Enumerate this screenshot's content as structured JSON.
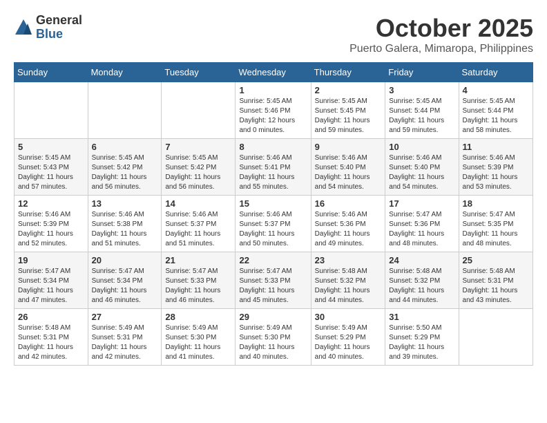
{
  "logo": {
    "general": "General",
    "blue": "Blue"
  },
  "title": "October 2025",
  "location": "Puerto Galera, Mimaropa, Philippines",
  "days_of_week": [
    "Sunday",
    "Monday",
    "Tuesday",
    "Wednesday",
    "Thursday",
    "Friday",
    "Saturday"
  ],
  "weeks": [
    [
      {
        "day": "",
        "info": ""
      },
      {
        "day": "",
        "info": ""
      },
      {
        "day": "",
        "info": ""
      },
      {
        "day": "1",
        "info": "Sunrise: 5:45 AM\nSunset: 5:46 PM\nDaylight: 12 hours\nand 0 minutes."
      },
      {
        "day": "2",
        "info": "Sunrise: 5:45 AM\nSunset: 5:45 PM\nDaylight: 11 hours\nand 59 minutes."
      },
      {
        "day": "3",
        "info": "Sunrise: 5:45 AM\nSunset: 5:44 PM\nDaylight: 11 hours\nand 59 minutes."
      },
      {
        "day": "4",
        "info": "Sunrise: 5:45 AM\nSunset: 5:44 PM\nDaylight: 11 hours\nand 58 minutes."
      }
    ],
    [
      {
        "day": "5",
        "info": "Sunrise: 5:45 AM\nSunset: 5:43 PM\nDaylight: 11 hours\nand 57 minutes."
      },
      {
        "day": "6",
        "info": "Sunrise: 5:45 AM\nSunset: 5:42 PM\nDaylight: 11 hours\nand 56 minutes."
      },
      {
        "day": "7",
        "info": "Sunrise: 5:45 AM\nSunset: 5:42 PM\nDaylight: 11 hours\nand 56 minutes."
      },
      {
        "day": "8",
        "info": "Sunrise: 5:46 AM\nSunset: 5:41 PM\nDaylight: 11 hours\nand 55 minutes."
      },
      {
        "day": "9",
        "info": "Sunrise: 5:46 AM\nSunset: 5:40 PM\nDaylight: 11 hours\nand 54 minutes."
      },
      {
        "day": "10",
        "info": "Sunrise: 5:46 AM\nSunset: 5:40 PM\nDaylight: 11 hours\nand 54 minutes."
      },
      {
        "day": "11",
        "info": "Sunrise: 5:46 AM\nSunset: 5:39 PM\nDaylight: 11 hours\nand 53 minutes."
      }
    ],
    [
      {
        "day": "12",
        "info": "Sunrise: 5:46 AM\nSunset: 5:39 PM\nDaylight: 11 hours\nand 52 minutes."
      },
      {
        "day": "13",
        "info": "Sunrise: 5:46 AM\nSunset: 5:38 PM\nDaylight: 11 hours\nand 51 minutes."
      },
      {
        "day": "14",
        "info": "Sunrise: 5:46 AM\nSunset: 5:37 PM\nDaylight: 11 hours\nand 51 minutes."
      },
      {
        "day": "15",
        "info": "Sunrise: 5:46 AM\nSunset: 5:37 PM\nDaylight: 11 hours\nand 50 minutes."
      },
      {
        "day": "16",
        "info": "Sunrise: 5:46 AM\nSunset: 5:36 PM\nDaylight: 11 hours\nand 49 minutes."
      },
      {
        "day": "17",
        "info": "Sunrise: 5:47 AM\nSunset: 5:36 PM\nDaylight: 11 hours\nand 48 minutes."
      },
      {
        "day": "18",
        "info": "Sunrise: 5:47 AM\nSunset: 5:35 PM\nDaylight: 11 hours\nand 48 minutes."
      }
    ],
    [
      {
        "day": "19",
        "info": "Sunrise: 5:47 AM\nSunset: 5:34 PM\nDaylight: 11 hours\nand 47 minutes."
      },
      {
        "day": "20",
        "info": "Sunrise: 5:47 AM\nSunset: 5:34 PM\nDaylight: 11 hours\nand 46 minutes."
      },
      {
        "day": "21",
        "info": "Sunrise: 5:47 AM\nSunset: 5:33 PM\nDaylight: 11 hours\nand 46 minutes."
      },
      {
        "day": "22",
        "info": "Sunrise: 5:47 AM\nSunset: 5:33 PM\nDaylight: 11 hours\nand 45 minutes."
      },
      {
        "day": "23",
        "info": "Sunrise: 5:48 AM\nSunset: 5:32 PM\nDaylight: 11 hours\nand 44 minutes."
      },
      {
        "day": "24",
        "info": "Sunrise: 5:48 AM\nSunset: 5:32 PM\nDaylight: 11 hours\nand 44 minutes."
      },
      {
        "day": "25",
        "info": "Sunrise: 5:48 AM\nSunset: 5:31 PM\nDaylight: 11 hours\nand 43 minutes."
      }
    ],
    [
      {
        "day": "26",
        "info": "Sunrise: 5:48 AM\nSunset: 5:31 PM\nDaylight: 11 hours\nand 42 minutes."
      },
      {
        "day": "27",
        "info": "Sunrise: 5:49 AM\nSunset: 5:31 PM\nDaylight: 11 hours\nand 42 minutes."
      },
      {
        "day": "28",
        "info": "Sunrise: 5:49 AM\nSunset: 5:30 PM\nDaylight: 11 hours\nand 41 minutes."
      },
      {
        "day": "29",
        "info": "Sunrise: 5:49 AM\nSunset: 5:30 PM\nDaylight: 11 hours\nand 40 minutes."
      },
      {
        "day": "30",
        "info": "Sunrise: 5:49 AM\nSunset: 5:29 PM\nDaylight: 11 hours\nand 40 minutes."
      },
      {
        "day": "31",
        "info": "Sunrise: 5:50 AM\nSunset: 5:29 PM\nDaylight: 11 hours\nand 39 minutes."
      },
      {
        "day": "",
        "info": ""
      }
    ]
  ]
}
